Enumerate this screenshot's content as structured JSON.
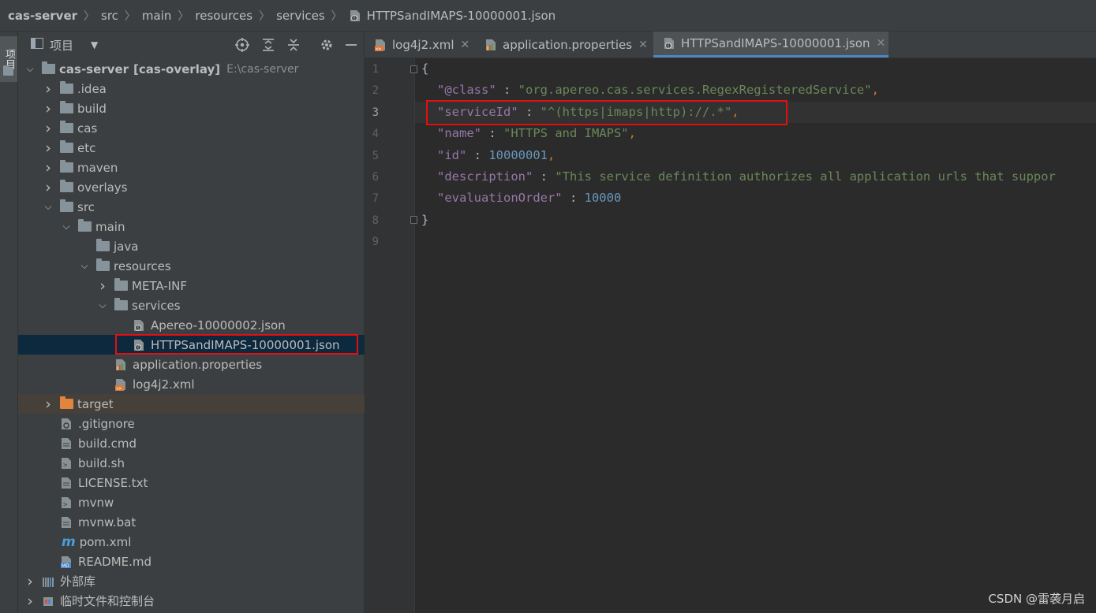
{
  "breadcrumb": [
    "cas-server",
    "src",
    "main",
    "resources",
    "services",
    "HTTPSandIMAPS-10000001.json"
  ],
  "side_strip": {
    "project_tab": "项目"
  },
  "project_panel": {
    "title": "项目",
    "header_icons": [
      "locate-icon",
      "expand-all-icon",
      "collapse-all-icon",
      "gear-icon",
      "minimize-icon"
    ]
  },
  "tree": [
    {
      "label": "cas-server",
      "suffix": "[cas-overlay]",
      "path": "E:\\cas-server",
      "icon": "module-folder",
      "expanded": true,
      "level": 0
    },
    {
      "label": ".idea",
      "icon": "folder",
      "expanded": false,
      "level": 1
    },
    {
      "label": "build",
      "icon": "folder",
      "expanded": false,
      "level": 1
    },
    {
      "label": "cas",
      "icon": "folder",
      "expanded": false,
      "level": 1
    },
    {
      "label": "etc",
      "icon": "folder",
      "expanded": false,
      "level": 1
    },
    {
      "label": "maven",
      "icon": "folder",
      "expanded": false,
      "level": 1
    },
    {
      "label": "overlays",
      "icon": "folder",
      "expanded": false,
      "level": 1
    },
    {
      "label": "src",
      "icon": "folder",
      "expanded": true,
      "level": 1
    },
    {
      "label": "main",
      "icon": "folder",
      "expanded": true,
      "level": 2
    },
    {
      "label": "java",
      "icon": "folder",
      "level": 3
    },
    {
      "label": "resources",
      "icon": "folder",
      "expanded": true,
      "level": 3
    },
    {
      "label": "META-INF",
      "icon": "folder",
      "expanded": false,
      "level": 4
    },
    {
      "label": "services",
      "icon": "folder",
      "expanded": true,
      "level": 4
    },
    {
      "label": "Apereo-10000002.json",
      "icon": "json-file",
      "level": 5
    },
    {
      "label": "HTTPSandIMAPS-10000001.json",
      "icon": "json-file",
      "level": 5,
      "selected": true
    },
    {
      "label": "application.properties",
      "icon": "properties-file",
      "level": 4
    },
    {
      "label": "log4j2.xml",
      "icon": "xml-file",
      "level": 4
    },
    {
      "label": "target",
      "icon": "excluded-folder",
      "expanded": false,
      "level": 1
    },
    {
      "label": ".gitignore",
      "icon": "gitignore-file",
      "level": 1
    },
    {
      "label": "build.cmd",
      "icon": "text-file",
      "level": 1
    },
    {
      "label": "build.sh",
      "icon": "shell-file",
      "level": 1
    },
    {
      "label": "LICENSE.txt",
      "icon": "text-file",
      "level": 1
    },
    {
      "label": "mvnw",
      "icon": "shell-file",
      "level": 1
    },
    {
      "label": "mvnw.bat",
      "icon": "text-file",
      "level": 1
    },
    {
      "label": "pom.xml",
      "icon": "maven-file",
      "level": 1
    },
    {
      "label": "README.md",
      "icon": "markdown-file",
      "level": 1
    },
    {
      "label": "外部库",
      "icon": "library",
      "expanded": false,
      "level": 0
    },
    {
      "label": "临时文件和控制台",
      "icon": "scratches",
      "expanded": false,
      "level": 0
    }
  ],
  "tabs": [
    {
      "label": "log4j2.xml",
      "icon": "xml-file"
    },
    {
      "label": "application.properties",
      "icon": "properties-file"
    },
    {
      "label": "HTTPSandIMAPS-10000001.json",
      "icon": "json-file",
      "active": true
    }
  ],
  "editor": {
    "line_numbers": [
      "1",
      "2",
      "3",
      "4",
      "5",
      "6",
      "7",
      "8",
      "9"
    ],
    "current_line": 3,
    "lines": [
      {
        "key": "",
        "value": "",
        "raw": "{"
      },
      {
        "key": "\"@class\"",
        "value": "\"org.apereo.cas.services.RegexRegisteredService\"",
        "type": "str",
        "comma": ","
      },
      {
        "key": "\"serviceId\"",
        "value": "\"^(https|imaps|http)://.*\"",
        "type": "str",
        "comma": ","
      },
      {
        "key": "\"name\"",
        "value": "\"HTTPS and IMAPS\"",
        "type": "str",
        "comma": ","
      },
      {
        "key": "\"id\"",
        "value": "10000001",
        "type": "num",
        "comma": ","
      },
      {
        "key": "\"description\"",
        "value": "\"This service definition authorizes all application urls that suppor",
        "type": "str",
        "comma": ""
      },
      {
        "key": "\"evaluationOrder\"",
        "value": "10000",
        "type": "num",
        "comma": ""
      },
      {
        "key": "",
        "value": "",
        "raw": "}"
      },
      {
        "key": "",
        "value": "",
        "raw": ""
      }
    ]
  },
  "watermark": "CSDN @雷袭月启",
  "colors": {
    "highlight_box": "#e41010",
    "selection": "#0d293e",
    "accent_tab": "#4a88c7"
  }
}
